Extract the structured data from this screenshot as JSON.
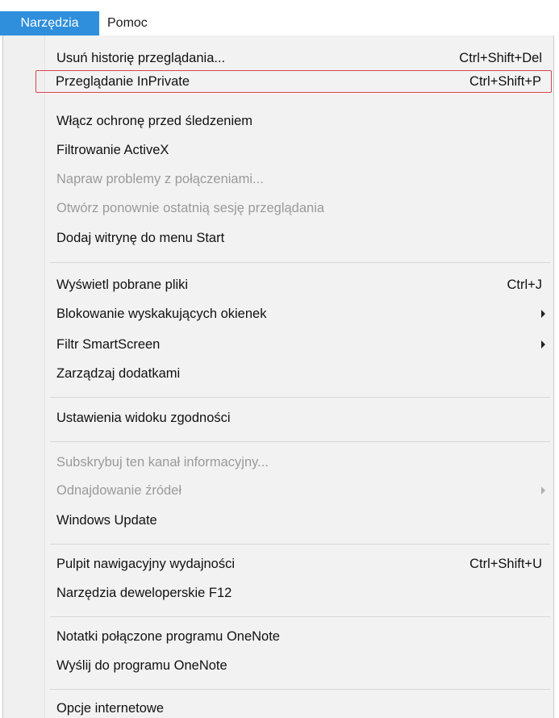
{
  "menubar": {
    "tools": "Narzędzia",
    "help": "Pomoc"
  },
  "menu": {
    "delete_history": {
      "label": "Usuń historię przeglądania...",
      "shortcut": "Ctrl+Shift+Del"
    },
    "inprivate": {
      "label": "Przeglądanie InPrivate",
      "shortcut": "Ctrl+Shift+P"
    },
    "tracking_protection": {
      "label": "Włącz ochronę przed śledzeniem"
    },
    "activex_filtering": {
      "label": "Filtrowanie ActiveX"
    },
    "fix_connection": {
      "label": "Napraw problemy z połączeniami..."
    },
    "reopen_session": {
      "label": "Otwórz ponownie ostatnią sesję przeglądania"
    },
    "add_to_start": {
      "label": "Dodaj witrynę do menu Start"
    },
    "downloads": {
      "label": "Wyświetl pobrane pliki",
      "shortcut": "Ctrl+J"
    },
    "popup_blocker": {
      "label": "Blokowanie wyskakujących okienek"
    },
    "smartscreen": {
      "label": "Filtr SmartScreen"
    },
    "manage_addons": {
      "label": "Zarządzaj dodatkami"
    },
    "compat_view": {
      "label": "Ustawienia widoku zgodności"
    },
    "subscribe_feed": {
      "label": "Subskrybuj ten kanał informacyjny..."
    },
    "feed_discovery": {
      "label": "Odnajdowanie źródeł"
    },
    "windows_update": {
      "label": "Windows Update"
    },
    "performance_dashboard": {
      "label": "Pulpit nawigacyjny wydajności",
      "shortcut": "Ctrl+Shift+U"
    },
    "dev_tools": {
      "label": "Narzędzia deweloperskie F12"
    },
    "onenote_linked": {
      "label": "Notatki połączone programu OneNote"
    },
    "send_onenote": {
      "label": "Wyślij do programu OneNote"
    },
    "internet_options": {
      "label": "Opcje internetowe"
    }
  },
  "colors": {
    "menubar_active": "#2f8fdc",
    "highlight_border": "#d9454f",
    "disabled_text": "#9a9a9a",
    "menu_background": "#f2f2f2"
  }
}
